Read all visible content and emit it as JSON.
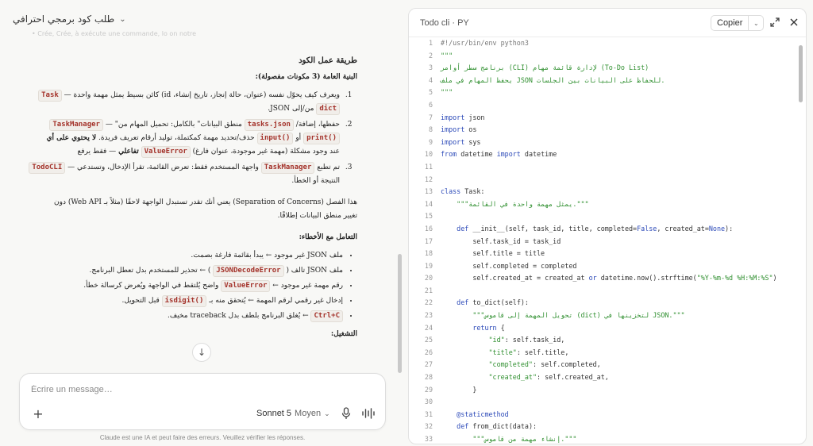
{
  "chat": {
    "title": "طلب كود برمجي احترافي",
    "faded_line": "• Crée, Crée, à exécute une commande, lo on notre",
    "section_title": "طريقة عمل الكود",
    "structure_heading": "البنية العامة (3 مكونات مفصولة):",
    "components": [
      {
        "code": "Task",
        "text_before": "ويعرف كيف يحوّل نفسه (عنوان، حالة إنجاز، تاريخ إنشاء، id) كائن بسيط يمثل مهمة واحدة — ",
        "code2": "dict",
        "text_after": " من/إلى JSON."
      },
      {
        "code": "TaskManager",
        "text1": "حفظها، إضافة/",
        "code2": "tasks.json",
        "text2": " منطق البيانات\" بالكامل: تحميل المهام من\" — ",
        "line2_code1": "print()",
        "line2_mid": " أو ",
        "line2_code2": "input()",
        "line2_text": " حذف/تحديد مهمة كمكتملة، توليد أرقام تعريف فريدة. ",
        "line2_bold": "لا يحتوي على أي",
        "line3_code": "ValueError",
        "line3_text": "عند وجود مشكلة (مهمة غير موجودة، عنوان فارغ) ",
        "line3_bold": "تفاعلي",
        "line3_end": " — فقط يرفع"
      },
      {
        "code": "TodoCLI",
        "text1": "تم تطبع ",
        "code2": "TaskManager",
        "text2": " واجهة المستخدم فقط: تعرض القائمة، تقرأ الإدخال، وتستدعي — ",
        "line2": "النتيجة أو الخطأ."
      }
    ],
    "separation_para_1": "هذا الفصل (Separation of Concerns) يعني أنك تقدر تستبدل الواجهة لاحقًا (مثلاً بـ Web API) دون",
    "separation_para_2": "تغيير منطق البيانات إطلاقًا.",
    "errors_heading": "التعامل مع الأخطاء:",
    "errors": [
      {
        "text": "ملف JSON غير موجود ← يبدأ بقائمة فارغة بصمت."
      },
      {
        "before": "ملف JSON تالف ( ",
        "code": "JSONDecodeError",
        "after": " ) ← تحذير للمستخدم بدل تعطل البرنامج."
      },
      {
        "before": "رقم مهمة غير موجود ← ",
        "code": "ValueError",
        "after": " واضح يُلتقط في الواجهة ويُعرض كرسالة خطأ."
      },
      {
        "before": "إدخال غير رقمي لرقم المهمة ← يُتحقق منه بـ ",
        "code": "isdigit()",
        "after": " قبل التحويل."
      },
      {
        "before": "",
        "code": "Ctrl+C",
        "after": " ← يُغلق البرنامج بلطف بدل traceback مخيف."
      }
    ],
    "run_heading": "التشغيل:"
  },
  "composer": {
    "placeholder": "Écrire un message…",
    "model": "Sonnet 5",
    "mode": "Moyen"
  },
  "disclaimer": "Claude est une IA et peut faire des erreurs. Veuillez vérifier les réponses.",
  "artifact": {
    "title": "Todo cli · PY",
    "copy_label": "Copier"
  },
  "code_lines": [
    {
      "n": "1",
      "t": "#!/usr/bin/env python3",
      "c": "cm"
    },
    {
      "n": "2",
      "t": "\"\"\"",
      "c": "str"
    },
    {
      "n": "3",
      "t": "برنامج سطر أوامر (CLI) لإدارة قائمة مهام (To-Do List)",
      "c": "str"
    },
    {
      "n": "4",
      "t": "يحفظ المهام في ملف JSON للحفاظ على البيانات بين الجلسات.",
      "c": "str"
    },
    {
      "n": "5",
      "t": "\"\"\"",
      "c": "str"
    },
    {
      "n": "6",
      "t": "",
      "c": ""
    },
    {
      "n": "7",
      "t": "import json",
      "c": "imp"
    },
    {
      "n": "8",
      "t": "import os",
      "c": "imp"
    },
    {
      "n": "9",
      "t": "import sys",
      "c": "imp"
    },
    {
      "n": "10",
      "t": "from datetime import datetime",
      "c": "from"
    },
    {
      "n": "11",
      "t": "",
      "c": ""
    },
    {
      "n": "12",
      "t": "",
      "c": ""
    },
    {
      "n": "13",
      "t": "class Task:",
      "c": "class"
    },
    {
      "n": "14",
      "t": "    \"\"\"يمثل مهمة واحدة في القائمة.\"\"\"",
      "c": "str"
    },
    {
      "n": "15",
      "t": "",
      "c": ""
    },
    {
      "n": "16",
      "t": "    def __init__(self, task_id, title, completed=False, created_at=None):",
      "c": "def"
    },
    {
      "n": "17",
      "t": "        self.task_id = task_id",
      "c": "self"
    },
    {
      "n": "18",
      "t": "        self.title = title",
      "c": "self"
    },
    {
      "n": "19",
      "t": "        self.completed = completed",
      "c": "self"
    },
    {
      "n": "20",
      "t": "        self.created_at = created_at or datetime.now().strftime(\"%Y-%m-%d %H:%M:%S\")",
      "c": "self"
    },
    {
      "n": "21",
      "t": "",
      "c": ""
    },
    {
      "n": "22",
      "t": "    def to_dict(self):",
      "c": "def"
    },
    {
      "n": "23",
      "t": "        \"\"\"تحويل المهمة إلى قاموس (dict) لتخزينها في JSON.\"\"\"",
      "c": "str"
    },
    {
      "n": "24",
      "t": "        return {",
      "c": "ret"
    },
    {
      "n": "25",
      "t": "            \"id\": self.task_id,",
      "c": "kv"
    },
    {
      "n": "26",
      "t": "            \"title\": self.title,",
      "c": "kv"
    },
    {
      "n": "27",
      "t": "            \"completed\": self.completed,",
      "c": "kv"
    },
    {
      "n": "28",
      "t": "            \"created_at\": self.created_at,",
      "c": "kv"
    },
    {
      "n": "29",
      "t": "        }",
      "c": ""
    },
    {
      "n": "30",
      "t": "",
      "c": ""
    },
    {
      "n": "31",
      "t": "    @staticmethod",
      "c": "deco"
    },
    {
      "n": "32",
      "t": "    def from_dict(data):",
      "c": "def"
    },
    {
      "n": "33",
      "t": "        \"\"\"إنشاء مهمة من قاموس.\"\"\"",
      "c": "str"
    }
  ]
}
